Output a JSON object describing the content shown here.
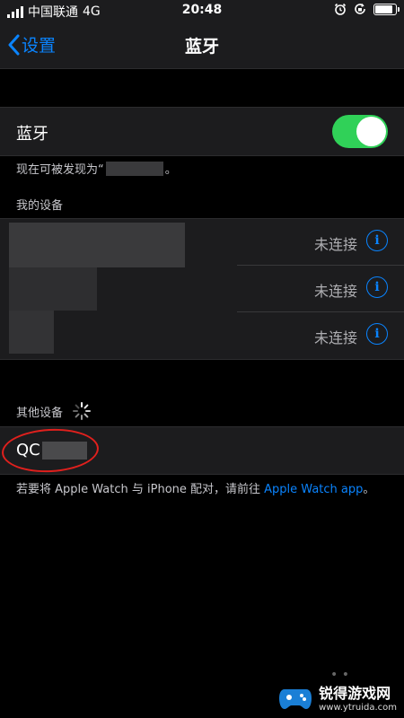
{
  "status_bar": {
    "carrier": "中国联通",
    "network": "4G",
    "time": "20:48",
    "battery_level": 0.95
  },
  "nav": {
    "back_label": "设置",
    "title": "蓝牙"
  },
  "bluetooth": {
    "label": "蓝牙",
    "enabled": true,
    "toggle_color": "#30d158",
    "discoverable_prefix": "现在可被发现为“",
    "discoverable_suffix": "。"
  },
  "my_devices": {
    "header": "我的设备",
    "items": [
      {
        "status": "未连接"
      },
      {
        "status": "未连接"
      },
      {
        "status": "未连接"
      }
    ]
  },
  "other_devices": {
    "header": "其他设备",
    "items": [
      {
        "name_visible": "QC"
      }
    ]
  },
  "footer": {
    "text": "若要将 Apple Watch 与 iPhone 配对，请前往 ",
    "link": "Apple Watch app",
    "end": "。"
  },
  "watermark": {
    "title": "锐得游戏网",
    "url": "www.ytruida.com"
  },
  "colors": {
    "accent": "#0a84ff",
    "background": "#000000",
    "cell": "#1c1c1e",
    "annotation": "#e0201d"
  }
}
